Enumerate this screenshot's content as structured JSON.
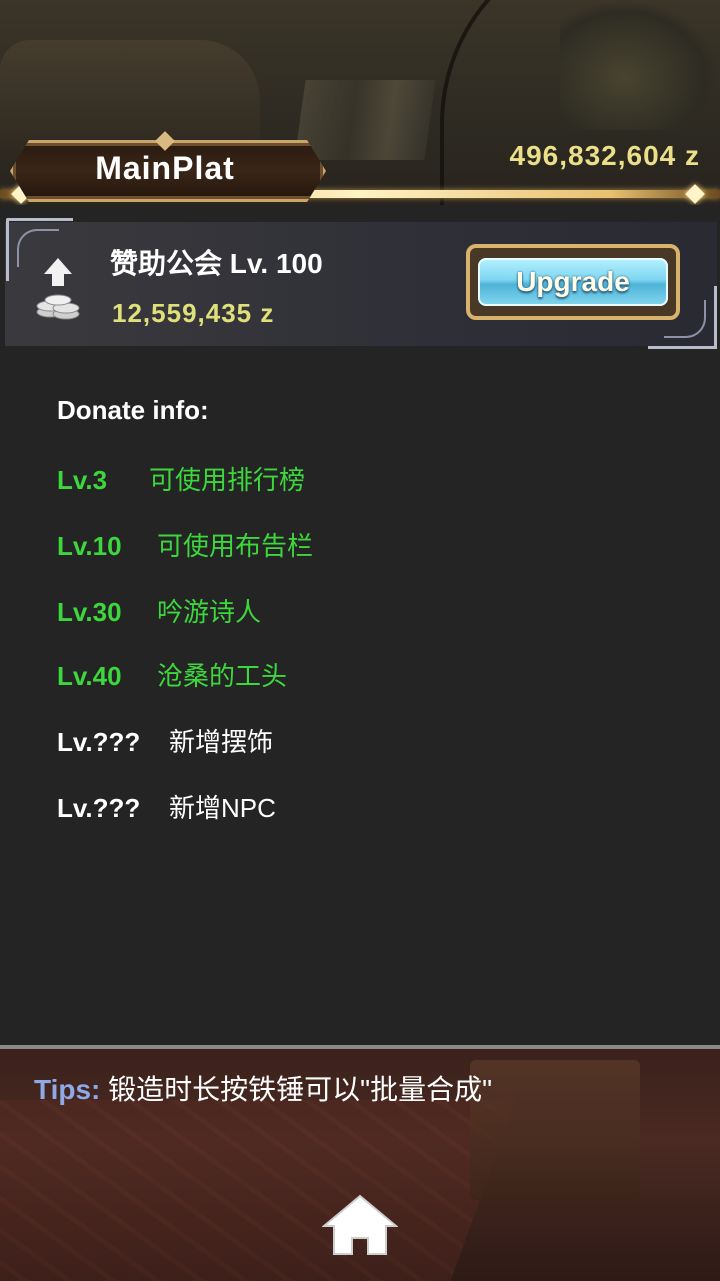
{
  "header": {
    "title": "MainPlat",
    "currency": "496,832,604 z"
  },
  "guild": {
    "name": "赞助公会",
    "level": "Lv. 100",
    "cost": "12,559,435 z",
    "upgrade_label": "Upgrade",
    "icon": "coin-stack-up-arrow-icon"
  },
  "donate": {
    "title": "Donate info:",
    "rows": [
      {
        "level": "Lv.3",
        "text": "可使用排行榜",
        "unlocked": true
      },
      {
        "level": "Lv.10",
        "text": "可使用布告栏",
        "unlocked": true
      },
      {
        "level": "Lv.30",
        "text": "吟游诗人",
        "unlocked": true
      },
      {
        "level": "Lv.40",
        "text": "沧桑的工头",
        "unlocked": true
      },
      {
        "level": "Lv.???",
        "text": "新增摆饰",
        "unlocked": false
      },
      {
        "level": "Lv.???",
        "text": "新增NPC",
        "unlocked": false
      }
    ]
  },
  "tips": {
    "label": "Tips:",
    "text": "锻造时长按铁锤可以\"批量合成\""
  },
  "footer": {
    "home_icon": "home-icon"
  },
  "colors": {
    "unlocked": "#3dd73d",
    "locked": "#ffffff",
    "currency": "#ecdf8a",
    "tips_label": "#8ea8e8"
  }
}
